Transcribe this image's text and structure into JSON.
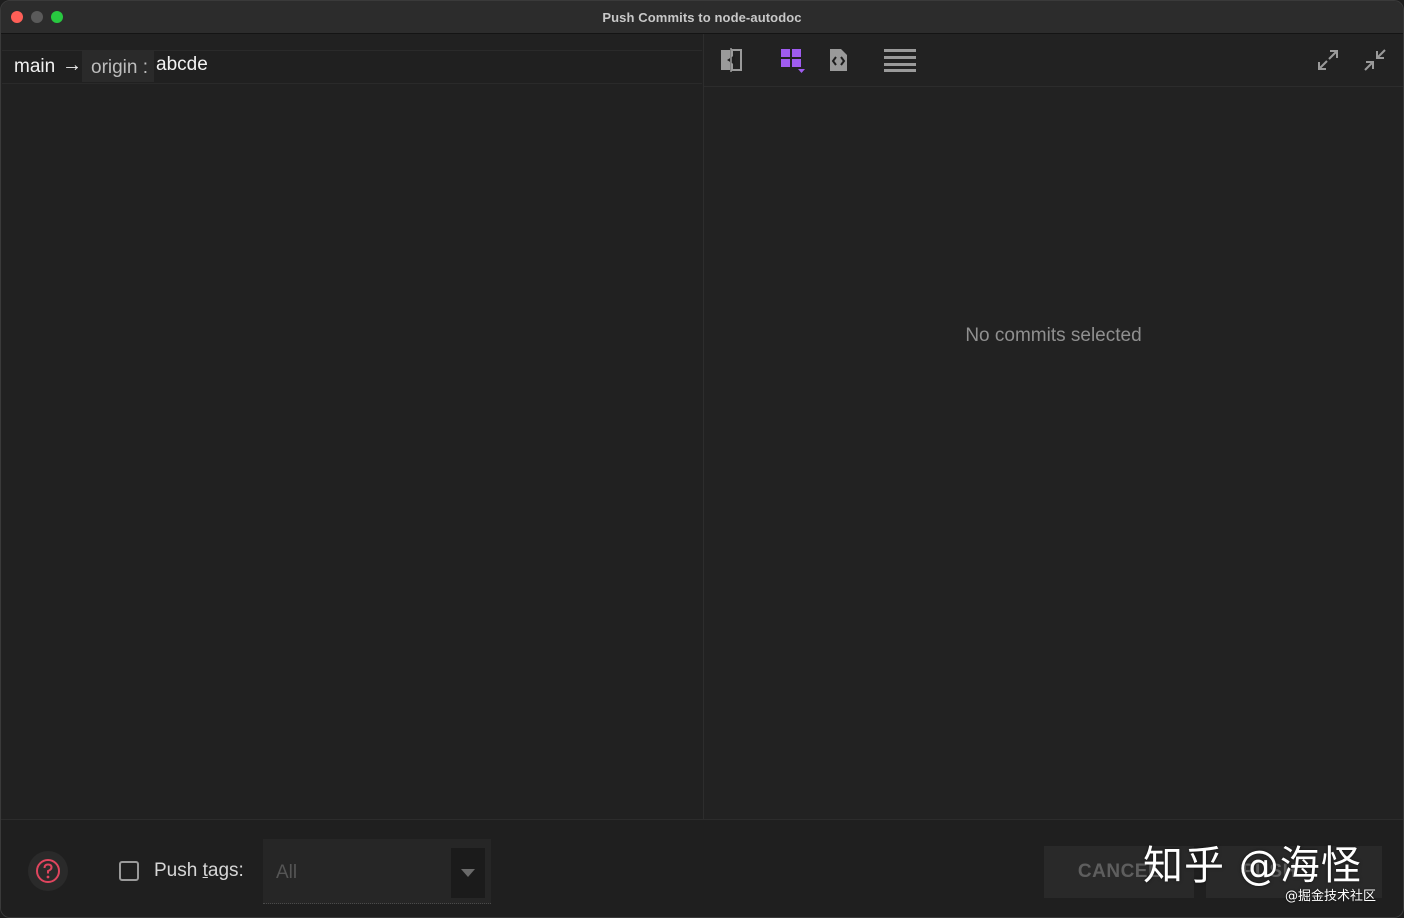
{
  "window": {
    "title": "Push Commits to node-autodoc"
  },
  "branch": {
    "local": "main",
    "arrow": "→",
    "remote": "origin :",
    "target": "abcde"
  },
  "details": {
    "empty_message": "No commits selected"
  },
  "toolbar": {
    "icons": [
      "compare-icon",
      "grid-view-icon",
      "code-file-icon",
      "menu-lines-icon",
      "expand-icon",
      "collapse-icon"
    ],
    "accent_color": "#a05cf0"
  },
  "footer": {
    "push_tags_label_prefix": "Push ",
    "push_tags_label_underlined": "t",
    "push_tags_label_suffix": "ags:",
    "push_tags_checked": false,
    "tags_select_value": "All",
    "cancel_label": "CANCEL",
    "push_label": "PUSH"
  },
  "watermark": {
    "main": "知乎 @海怪",
    "sub": "@掘金技术社区"
  }
}
